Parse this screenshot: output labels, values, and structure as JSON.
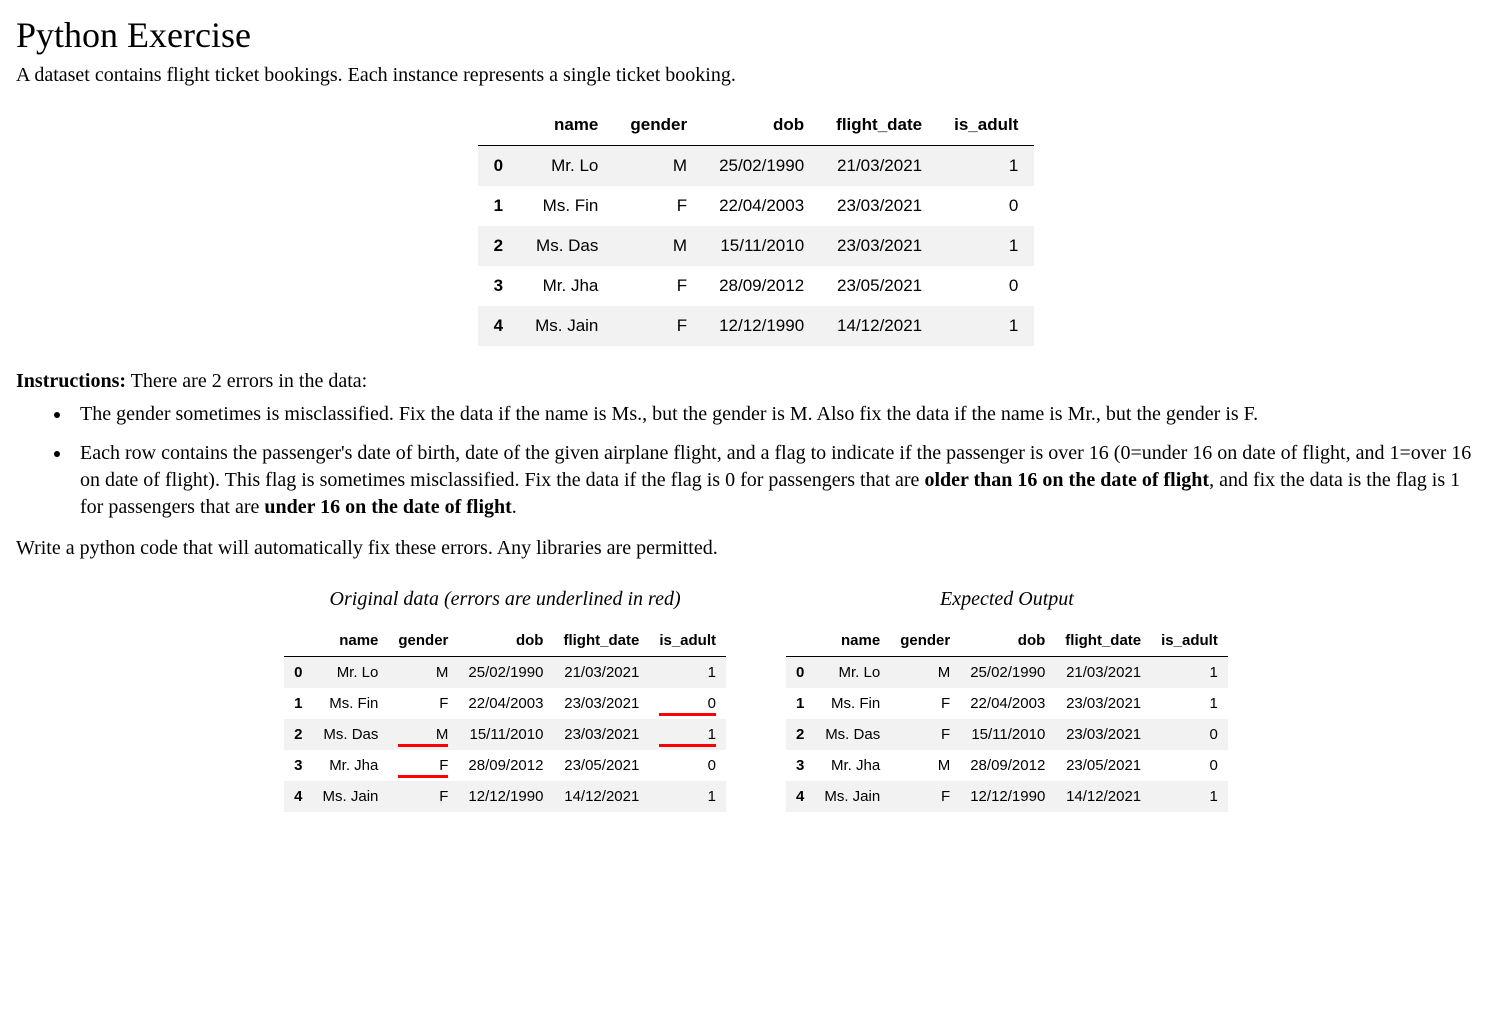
{
  "title": "Python Exercise",
  "intro": "A dataset contains flight ticket bookings. Each instance represents a single ticket booking.",
  "columns": [
    "name",
    "gender",
    "dob",
    "flight_date",
    "is_adult"
  ],
  "main_rows": [
    {
      "idx": "0",
      "name": "Mr. Lo",
      "gender": "M",
      "dob": "25/02/1990",
      "flight_date": "21/03/2021",
      "is_adult": "1"
    },
    {
      "idx": "1",
      "name": "Ms. Fin",
      "gender": "F",
      "dob": "22/04/2003",
      "flight_date": "23/03/2021",
      "is_adult": "0"
    },
    {
      "idx": "2",
      "name": "Ms. Das",
      "gender": "M",
      "dob": "15/11/2010",
      "flight_date": "23/03/2021",
      "is_adult": "1"
    },
    {
      "idx": "3",
      "name": "Mr. Jha",
      "gender": "F",
      "dob": "28/09/2012",
      "flight_date": "23/05/2021",
      "is_adult": "0"
    },
    {
      "idx": "4",
      "name": "Ms. Jain",
      "gender": "F",
      "dob": "12/12/1990",
      "flight_date": "14/12/2021",
      "is_adult": "1"
    }
  ],
  "instructions_lead_bold": "Instructions:",
  "instructions_lead_rest": " There are 2 errors in the data:",
  "bullet1": "The gender sometimes is misclassified. Fix the data if the name is Ms., but the gender is M. Also fix the data if the name is Mr., but the gender is F.",
  "bullet2_a": "Each row contains the passenger's date of birth, date of the given airplane flight, and a flag to indicate if the passenger is over 16 (0=under 16 on date of flight, and 1=over 16 on date of flight). This flag is sometimes misclassified. Fix the data if the flag is 0 for passengers that are ",
  "bullet2_b": "older than 16 on the date of flight",
  "bullet2_c": ", and fix the data is the flag is 1 for passengers that are ",
  "bullet2_d": "under 16 on the date of flight",
  "bullet2_e": ".",
  "write_line": "Write a python code that will automatically fix these errors. Any libraries are permitted.",
  "caption_original": "Original data (errors are underlined in red)",
  "caption_expected": "Expected Output",
  "original_rows": [
    {
      "idx": "0",
      "name": "Mr. Lo",
      "gender": "M",
      "dob": "25/02/1990",
      "flight_date": "21/03/2021",
      "is_adult": "1",
      "err": {}
    },
    {
      "idx": "1",
      "name": "Ms. Fin",
      "gender": "F",
      "dob": "22/04/2003",
      "flight_date": "23/03/2021",
      "is_adult": "0",
      "err": {
        "is_adult": true
      }
    },
    {
      "idx": "2",
      "name": "Ms. Das",
      "gender": "M",
      "dob": "15/11/2010",
      "flight_date": "23/03/2021",
      "is_adult": "1",
      "err": {
        "gender": true,
        "is_adult": true
      }
    },
    {
      "idx": "3",
      "name": "Mr. Jha",
      "gender": "F",
      "dob": "28/09/2012",
      "flight_date": "23/05/2021",
      "is_adult": "0",
      "err": {
        "gender": true
      }
    },
    {
      "idx": "4",
      "name": "Ms. Jain",
      "gender": "F",
      "dob": "12/12/1990",
      "flight_date": "14/12/2021",
      "is_adult": "1",
      "err": {}
    }
  ],
  "expected_rows": [
    {
      "idx": "0",
      "name": "Mr. Lo",
      "gender": "M",
      "dob": "25/02/1990",
      "flight_date": "21/03/2021",
      "is_adult": "1"
    },
    {
      "idx": "1",
      "name": "Ms. Fin",
      "gender": "F",
      "dob": "22/04/2003",
      "flight_date": "23/03/2021",
      "is_adult": "1"
    },
    {
      "idx": "2",
      "name": "Ms. Das",
      "gender": "F",
      "dob": "15/11/2010",
      "flight_date": "23/03/2021",
      "is_adult": "0"
    },
    {
      "idx": "3",
      "name": "Mr. Jha",
      "gender": "M",
      "dob": "28/09/2012",
      "flight_date": "23/05/2021",
      "is_adult": "0"
    },
    {
      "idx": "4",
      "name": "Ms. Jain",
      "gender": "F",
      "dob": "12/12/1990",
      "flight_date": "14/12/2021",
      "is_adult": "1"
    }
  ]
}
